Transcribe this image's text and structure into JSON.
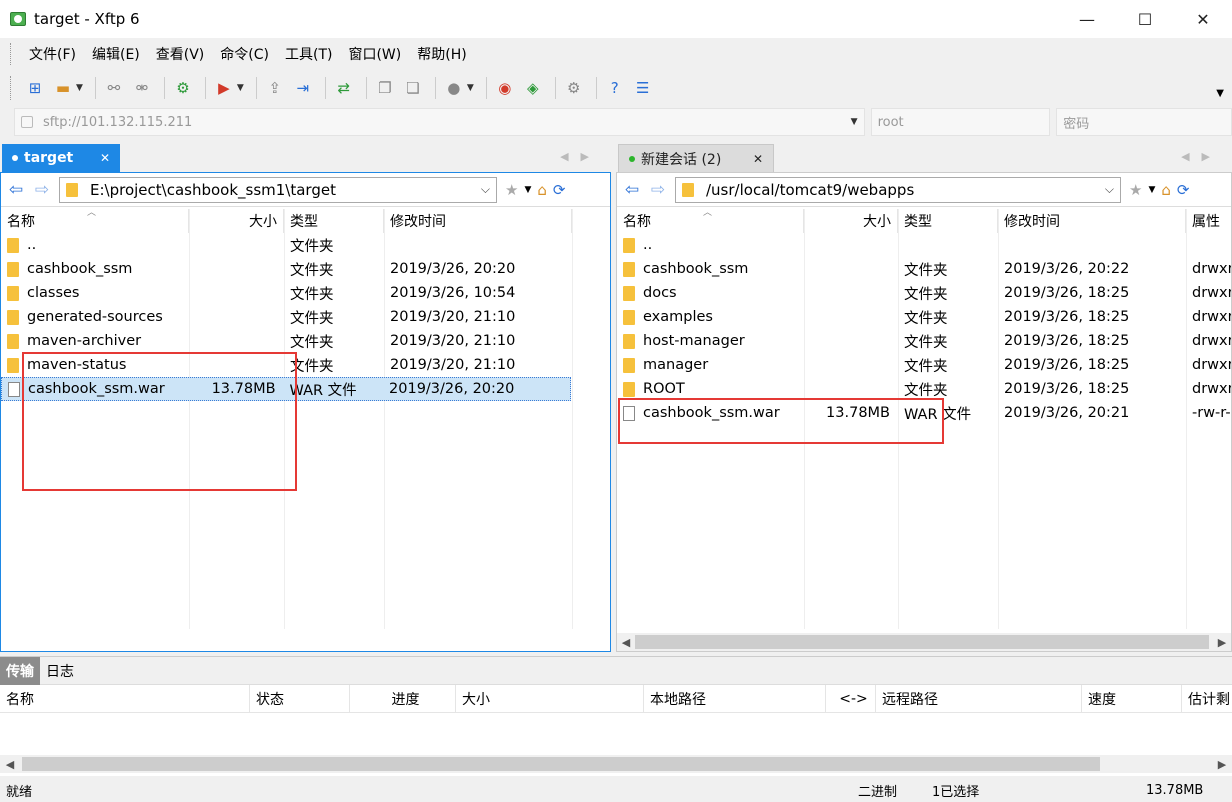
{
  "window": {
    "title": "target - Xftp 6",
    "minimize": "—",
    "maximize": "☐",
    "close": "✕"
  },
  "menu": [
    "文件(F)",
    "编辑(E)",
    "查看(V)",
    "命令(C)",
    "工具(T)",
    "窗口(W)",
    "帮助(H)"
  ],
  "address": {
    "url": "sftp://101.132.115.211",
    "user_placeholder": "root",
    "password_placeholder": "密码"
  },
  "left_pane": {
    "tab_label": "target",
    "path": "E:\\project\\cashbook_ssm1\\target",
    "columns": [
      "名称",
      "大小",
      "类型",
      "修改时间"
    ],
    "rows": [
      {
        "name": "..",
        "size": "",
        "type": "文件夹",
        "modified": "",
        "kind": "folder"
      },
      {
        "name": "cashbook_ssm",
        "size": "",
        "type": "文件夹",
        "modified": "2019/3/26, 20:20",
        "kind": "folder"
      },
      {
        "name": "classes",
        "size": "",
        "type": "文件夹",
        "modified": "2019/3/26, 10:54",
        "kind": "folder"
      },
      {
        "name": "generated-sources",
        "size": "",
        "type": "文件夹",
        "modified": "2019/3/20, 21:10",
        "kind": "folder"
      },
      {
        "name": "maven-archiver",
        "size": "",
        "type": "文件夹",
        "modified": "2019/3/20, 21:10",
        "kind": "folder"
      },
      {
        "name": "maven-status",
        "size": "",
        "type": "文件夹",
        "modified": "2019/3/20, 21:10",
        "kind": "folder"
      },
      {
        "name": "cashbook_ssm.war",
        "size": "13.78MB",
        "type": "WAR 文件",
        "modified": "2019/3/26, 20:20",
        "kind": "file"
      }
    ]
  },
  "right_pane": {
    "tab_label": "新建会话 (2)",
    "path": "/usr/local/tomcat9/webapps",
    "columns": [
      "名称",
      "大小",
      "类型",
      "修改时间",
      "属性"
    ],
    "rows": [
      {
        "name": "..",
        "size": "",
        "type": "",
        "modified": "",
        "attr": "",
        "kind": "folder"
      },
      {
        "name": "cashbook_ssm",
        "size": "",
        "type": "文件夹",
        "modified": "2019/3/26, 20:22",
        "attr": "drwxr",
        "kind": "folder"
      },
      {
        "name": "docs",
        "size": "",
        "type": "文件夹",
        "modified": "2019/3/26, 18:25",
        "attr": "drwxr",
        "kind": "folder"
      },
      {
        "name": "examples",
        "size": "",
        "type": "文件夹",
        "modified": "2019/3/26, 18:25",
        "attr": "drwxr",
        "kind": "folder"
      },
      {
        "name": "host-manager",
        "size": "",
        "type": "文件夹",
        "modified": "2019/3/26, 18:25",
        "attr": "drwxr",
        "kind": "folder"
      },
      {
        "name": "manager",
        "size": "",
        "type": "文件夹",
        "modified": "2019/3/26, 18:25",
        "attr": "drwxr",
        "kind": "folder"
      },
      {
        "name": "ROOT",
        "size": "",
        "type": "文件夹",
        "modified": "2019/3/26, 18:25",
        "attr": "drwxr",
        "kind": "folder"
      },
      {
        "name": "cashbook_ssm.war",
        "size": "13.78MB",
        "type": "WAR 文件",
        "modified": "2019/3/26, 20:21",
        "attr": "-rw-r-",
        "kind": "file"
      }
    ]
  },
  "transfer": {
    "tabs": [
      "传输",
      "日志"
    ],
    "columns": [
      "名称",
      "状态",
      "进度",
      "大小",
      "本地路径",
      "<->",
      "远程路径",
      "速度",
      "估计剩"
    ]
  },
  "status": {
    "ready": "就绪",
    "mode": "二进制",
    "selection": "1已选择",
    "size": "13.78MB"
  },
  "colors": {
    "accent": "#1e88e5",
    "folder": "#f6c13c",
    "highlight_box": "#e53935",
    "selected_row": "#cce4f7"
  }
}
